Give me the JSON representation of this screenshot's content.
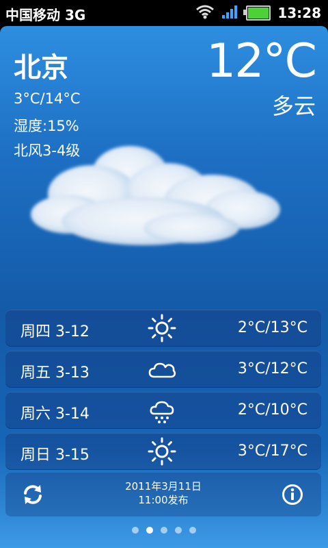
{
  "status_bar": {
    "carrier": "中国移动 3G",
    "time": "13:28",
    "icons": [
      "wifi-icon",
      "signal-icon",
      "battery-icon"
    ]
  },
  "current": {
    "city": "北京",
    "temp_range": "3°C/14°C",
    "humidity": "湿度:15%",
    "wind": "北风3-4级",
    "temperature": "12°C",
    "condition": "多云",
    "condition_icon": "cloud"
  },
  "forecast": [
    {
      "day": "周四 3-12",
      "icon": "sunny-icon",
      "temp": "2°C/13°C"
    },
    {
      "day": "周五 3-13",
      "icon": "cloudy-icon",
      "temp": "3°C/12°C"
    },
    {
      "day": "周六 3-14",
      "icon": "snow-icon",
      "temp": "2°C/10°C"
    },
    {
      "day": "周日 3-15",
      "icon": "sunny-icon",
      "temp": "3°C/17°C"
    }
  ],
  "footer": {
    "date": "2011年3月11日",
    "publish": "11:00发布",
    "refresh_icon": "refresh-icon",
    "info_icon": "info-icon"
  },
  "pager": {
    "count": 5,
    "active": 2
  }
}
